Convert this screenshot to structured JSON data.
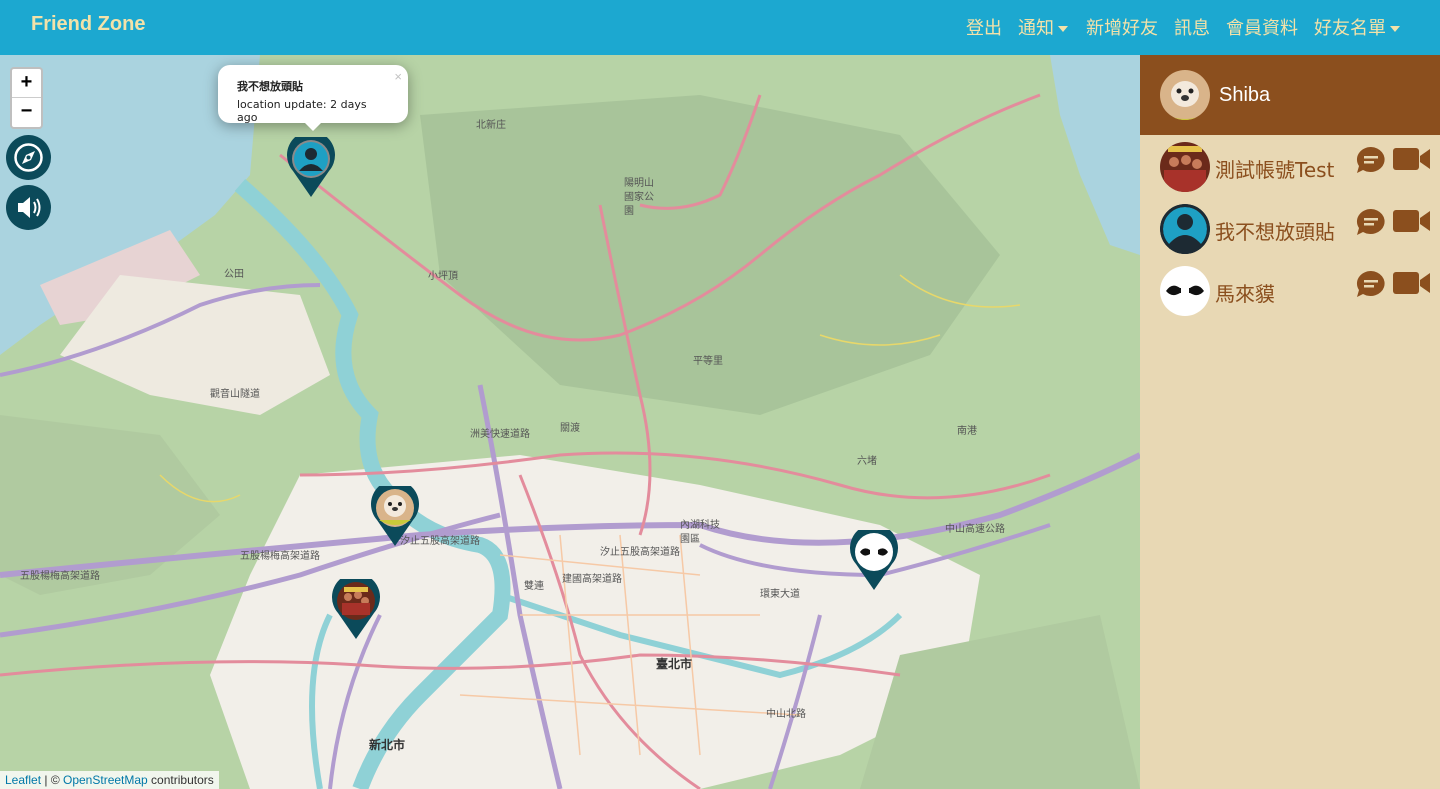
{
  "navbar": {
    "brand": "Friend Zone",
    "logout": "登出",
    "notifications": "通知",
    "add_friend": "新增好友",
    "messages": "訊息",
    "profile": "會員資料",
    "friend_list": "好友名單"
  },
  "map": {
    "popup": {
      "title": "我不想放頭貼",
      "text": "location update: 2 days ago"
    },
    "zoom_in": "+",
    "zoom_out": "−",
    "labels": {
      "yangmingshan": "陽明山國家公園",
      "taipei": "臺北市",
      "new_taipei": "新北市",
      "neihu": "內湖科技園區",
      "huandong": "環東大道",
      "zhongshan_hwy": "中山高速公路",
      "xizhi_elevated": "汐止五股高架道路",
      "wugu_elevated": "五股楊梅高架道路",
      "zhoumei": "洲美快速道路",
      "guandu": "關渡",
      "pingdeng": "平等里",
      "shuanglian": "雙連",
      "xinbeipu": "北新庄",
      "dagong": "公田",
      "xiaoyou": "小坪頂",
      "nangang": "南港",
      "liuqi": "六堵",
      "jianguo": "建國高架道路",
      "zhongshan_n": "中山北路",
      "guandu_plain": "觀音山隧道"
    },
    "attribution": {
      "leaflet": "Leaflet",
      "sep": " | © ",
      "osm": "OpenStreetMap",
      "contributors": " contributors"
    }
  },
  "sidebar": {
    "me": {
      "name": "Shiba"
    },
    "friends": [
      {
        "name": "測試帳號Test"
      },
      {
        "name": "我不想放頭貼"
      },
      {
        "name": "馬來貘"
      }
    ]
  },
  "colors": {
    "navbar_bg": "#1ca8d0",
    "nav_text": "#f3e2a9",
    "sidebar_bg": "#e8d8b4",
    "me_bg": "#8b4f1e",
    "friend_text": "#8b4f1e",
    "marker": "#0b4a5a"
  },
  "icons": {
    "compass": "compass-icon",
    "voice": "speaker-icon",
    "chat": "chat-bubble-icon",
    "video": "video-camera-icon",
    "default_avatar": "user-avatar-icon"
  }
}
